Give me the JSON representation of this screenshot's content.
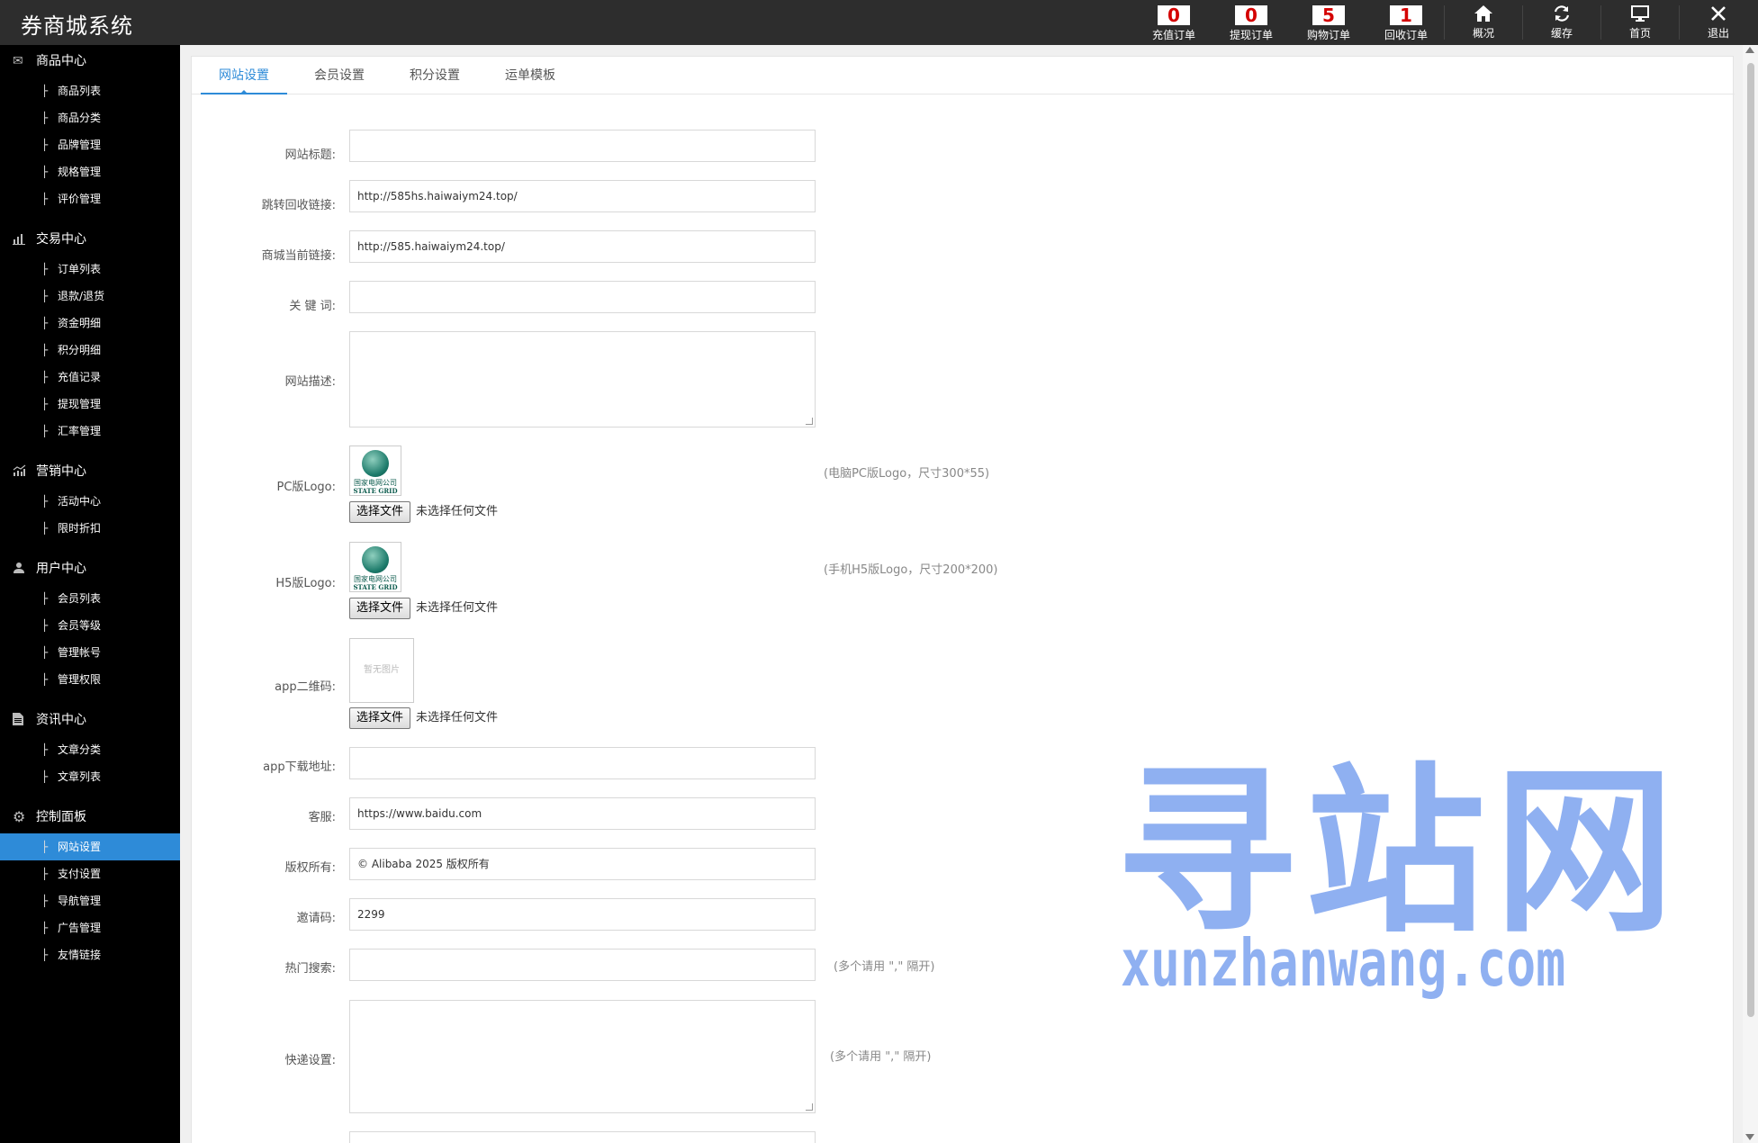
{
  "app": {
    "title": "券商城系统"
  },
  "header": {
    "counters": [
      {
        "count": "0",
        "label": "充值订单"
      },
      {
        "count": "0",
        "label": "提现订单"
      },
      {
        "count": "5",
        "label": "购物订单"
      },
      {
        "count": "1",
        "label": "回收订单"
      }
    ],
    "actions": [
      {
        "icon": "home-icon",
        "label": "概况"
      },
      {
        "icon": "refresh-icon",
        "label": "缓存"
      },
      {
        "icon": "monitor-icon",
        "label": "首页"
      },
      {
        "icon": "close-icon",
        "label": "退出"
      }
    ]
  },
  "sidebar": {
    "groups": [
      {
        "title": "商品中心",
        "icon": "envelope-icon",
        "items": [
          "商品列表",
          "商品分类",
          "品牌管理",
          "规格管理",
          "评价管理"
        ]
      },
      {
        "title": "交易中心",
        "icon": "bar-chart-icon",
        "items": [
          "订单列表",
          "退款/退货",
          "资金明细",
          "积分明细",
          "充值记录",
          "提现管理",
          "汇率管理"
        ]
      },
      {
        "title": "营销中心",
        "icon": "growth-chart-icon",
        "items": [
          "活动中心",
          "限时折扣"
        ]
      },
      {
        "title": "用户中心",
        "icon": "user-icon",
        "items": [
          "会员列表",
          "会员等级",
          "管理帐号",
          "管理权限"
        ]
      },
      {
        "title": "资讯中心",
        "icon": "document-icon",
        "items": [
          "文章分类",
          "文章列表"
        ]
      },
      {
        "title": "控制面板",
        "icon": "gear-icon",
        "items": [
          "网站设置",
          "支付设置",
          "导航管理",
          "广告管理",
          "友情链接"
        ]
      }
    ],
    "active_item": "网站设置"
  },
  "tabs": [
    "网站设置",
    "会员设置",
    "积分设置",
    "运单模板"
  ],
  "form": {
    "site_title": {
      "label": "网站标题:",
      "value": ""
    },
    "recycle_link": {
      "label": "跳转回收链接:",
      "value": "http://585hs.haiwaiym24.top/"
    },
    "mall_link": {
      "label": "商城当前链接:",
      "value": "http://585.haiwaiym24.top/"
    },
    "keywords": {
      "label": "关 键 词:",
      "value": ""
    },
    "description": {
      "label": "网站描述:",
      "value": ""
    },
    "pc_logo": {
      "label": "PC版Logo:",
      "hint": "(电脑PC版Logo，尺寸300*55)"
    },
    "h5_logo": {
      "label": "H5版Logo:",
      "hint": "(手机H5版Logo，尺寸200*200)"
    },
    "app_qr": {
      "label": "app二维码:",
      "placeholder": "暂无图片"
    },
    "app_download": {
      "label": "app下载地址:",
      "value": ""
    },
    "service": {
      "label": "客服:",
      "value": "https://www.baidu.com"
    },
    "copyright": {
      "label": "版权所有:",
      "value": "©  Alibaba 2025 版权所有"
    },
    "invite_code": {
      "label": "邀请码:",
      "value": "2299"
    },
    "hot_search": {
      "label": "热门搜索:",
      "value": "",
      "hint": "(多个请用 \",\" 隔开)"
    },
    "express": {
      "label": "快递设置:",
      "hint": "(多个请用 \",\" 隔开)"
    },
    "file_button": "选择文件",
    "no_file": "未选择任何文件",
    "logo_cn": "国家电网公司",
    "logo_en": "STATE GRID"
  },
  "watermark": {
    "big": "寻站网",
    "small": "xunzhanwang.com"
  }
}
